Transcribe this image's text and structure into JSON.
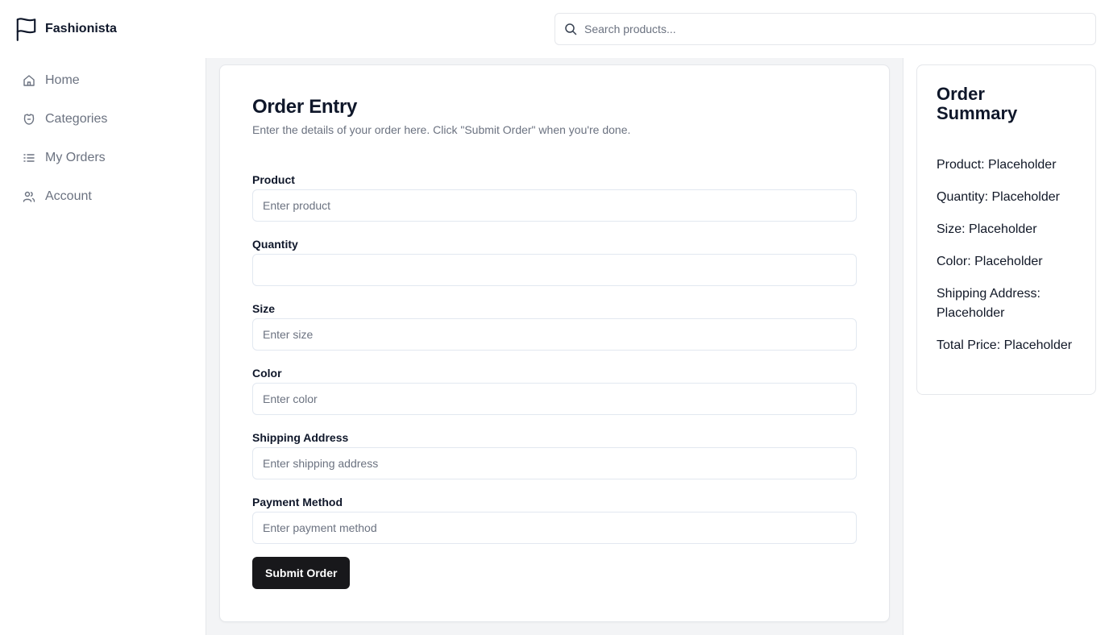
{
  "brand": {
    "name": "Fashionista",
    "icon": "flag-icon"
  },
  "search": {
    "placeholder": "Search products...",
    "value": ""
  },
  "sidebar": {
    "items": [
      {
        "label": "Home",
        "icon": "home-icon"
      },
      {
        "label": "Categories",
        "icon": "shirt-icon"
      },
      {
        "label": "My Orders",
        "icon": "list-icon"
      },
      {
        "label": "Account",
        "icon": "users-icon"
      }
    ]
  },
  "form": {
    "title": "Order Entry",
    "description": "Enter the details of your order here. Click \"Submit Order\" when you're done.",
    "fields": [
      {
        "label": "Product",
        "placeholder": "Enter product",
        "value": ""
      },
      {
        "label": "Quantity",
        "placeholder": "",
        "value": ""
      },
      {
        "label": "Size",
        "placeholder": "Enter size",
        "value": ""
      },
      {
        "label": "Color",
        "placeholder": "Enter color",
        "value": ""
      },
      {
        "label": "Shipping Address",
        "placeholder": "Enter shipping address",
        "value": ""
      },
      {
        "label": "Payment Method",
        "placeholder": "Enter payment method",
        "value": ""
      }
    ],
    "submit_label": "Submit Order"
  },
  "summary": {
    "title": "Order Summary",
    "lines": [
      "Product: Placeholder",
      "Quantity: Placeholder",
      "Size: Placeholder",
      "Color: Placeholder",
      "Shipping Address: Placeholder",
      "Total Price: Placeholder"
    ]
  },
  "colors": {
    "accent": "#18181b",
    "muted_text": "#6b7280",
    "border": "#e5e7eb",
    "main_background": "#f3f4f6"
  }
}
